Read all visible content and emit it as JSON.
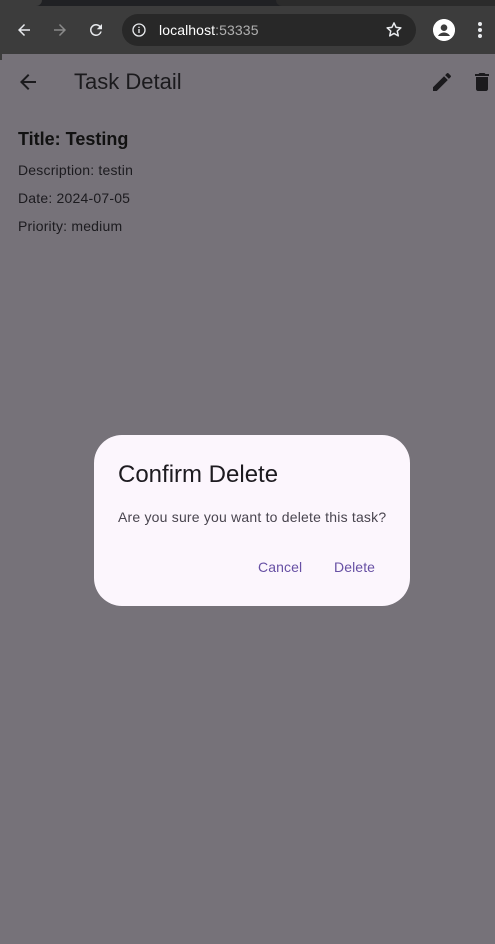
{
  "browser": {
    "url_host": "localhost",
    "url_port": ":53335"
  },
  "app_bar": {
    "title": "Task Detail"
  },
  "task": {
    "title": "Title: Testing",
    "description": "Description: testin",
    "date": "Date: 2024-07-05",
    "priority": "Priority: medium"
  },
  "dialog": {
    "title": "Confirm Delete",
    "message": "Are you sure you want to delete this task?",
    "cancel_label": "Cancel",
    "delete_label": "Delete"
  },
  "colors": {
    "scrim": "#767279",
    "dialog_bg": "#fcf6fd",
    "accent": "#6750a4",
    "chrome_bg": "#3c3c3c"
  }
}
